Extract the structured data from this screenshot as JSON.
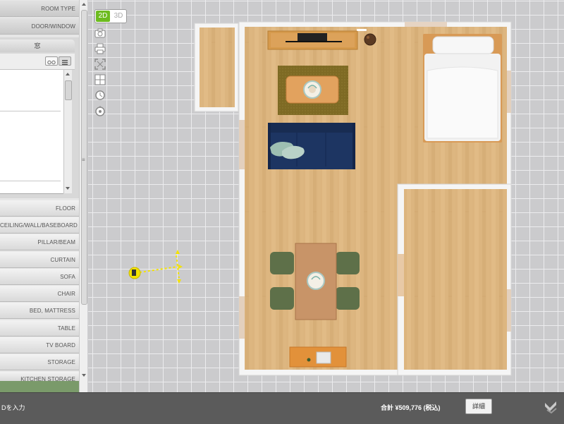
{
  "view_toggle": {
    "mode_2d": "2D",
    "mode_3d": "3D"
  },
  "categories_top": [
    "ROOM TYPE",
    "DOOR/WINDOW"
  ],
  "subpanel": {
    "tab_label": "窓"
  },
  "categories": [
    "FLOOR",
    "CEILING/WALL/BASEBOARD",
    "PILLAR/BEAM",
    "CURTAIN",
    "SOFA",
    "CHAIR",
    "BED, MATTRESS",
    "TABLE",
    "TV BOARD",
    "STORAGE",
    "KITCHEN STORAGE"
  ],
  "tools": [
    "camera-icon",
    "print-icon",
    "fit-screen-icon",
    "grid-icon",
    "rotate-icon",
    "reset-view-icon"
  ],
  "footer": {
    "id_input_label": "Dを入力",
    "total_label": "合計 ¥509,776 (税込)",
    "detail_button": "詳細"
  },
  "colors": {
    "accent_green": "#6dbb1f",
    "floor_wood": "#dcb57f",
    "grid_bg": "#cbcbcd",
    "footer_bg": "#5b5b5b",
    "marker_yellow": "#f4e300"
  }
}
